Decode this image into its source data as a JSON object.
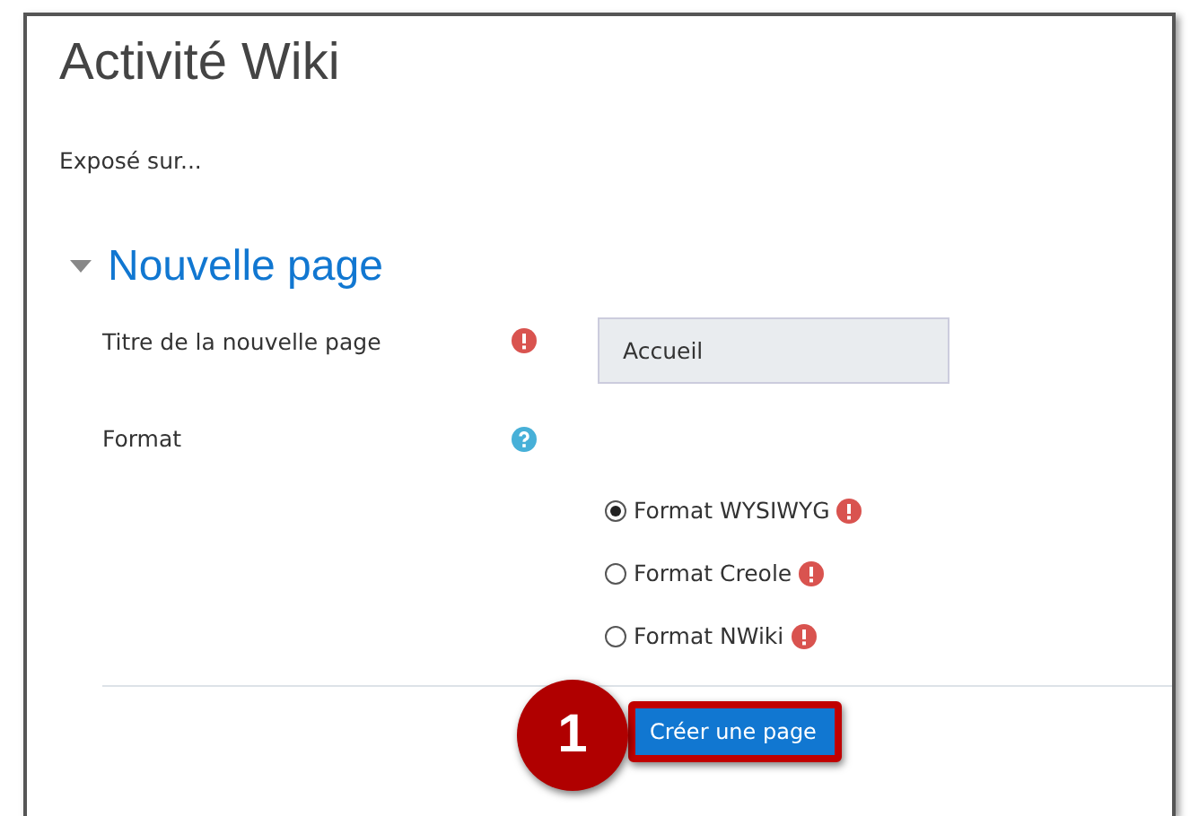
{
  "title": "Activité Wiki",
  "description": "Exposé sur...",
  "section": {
    "title": "Nouvelle page",
    "expanded": true
  },
  "fields": [
    {
      "label": "Titre de la nouvelle page",
      "kind": "required",
      "value": "Accueil"
    },
    {
      "label": "Format",
      "kind": "help"
    }
  ],
  "format_options": [
    {
      "label": "Format WYSIWYG",
      "selected": true
    },
    {
      "label": "Format Creole",
      "selected": false
    },
    {
      "label": "Format NWiki",
      "selected": false
    }
  ],
  "submit": {
    "label": "Créer une page",
    "highlighted": true,
    "step": "1"
  }
}
